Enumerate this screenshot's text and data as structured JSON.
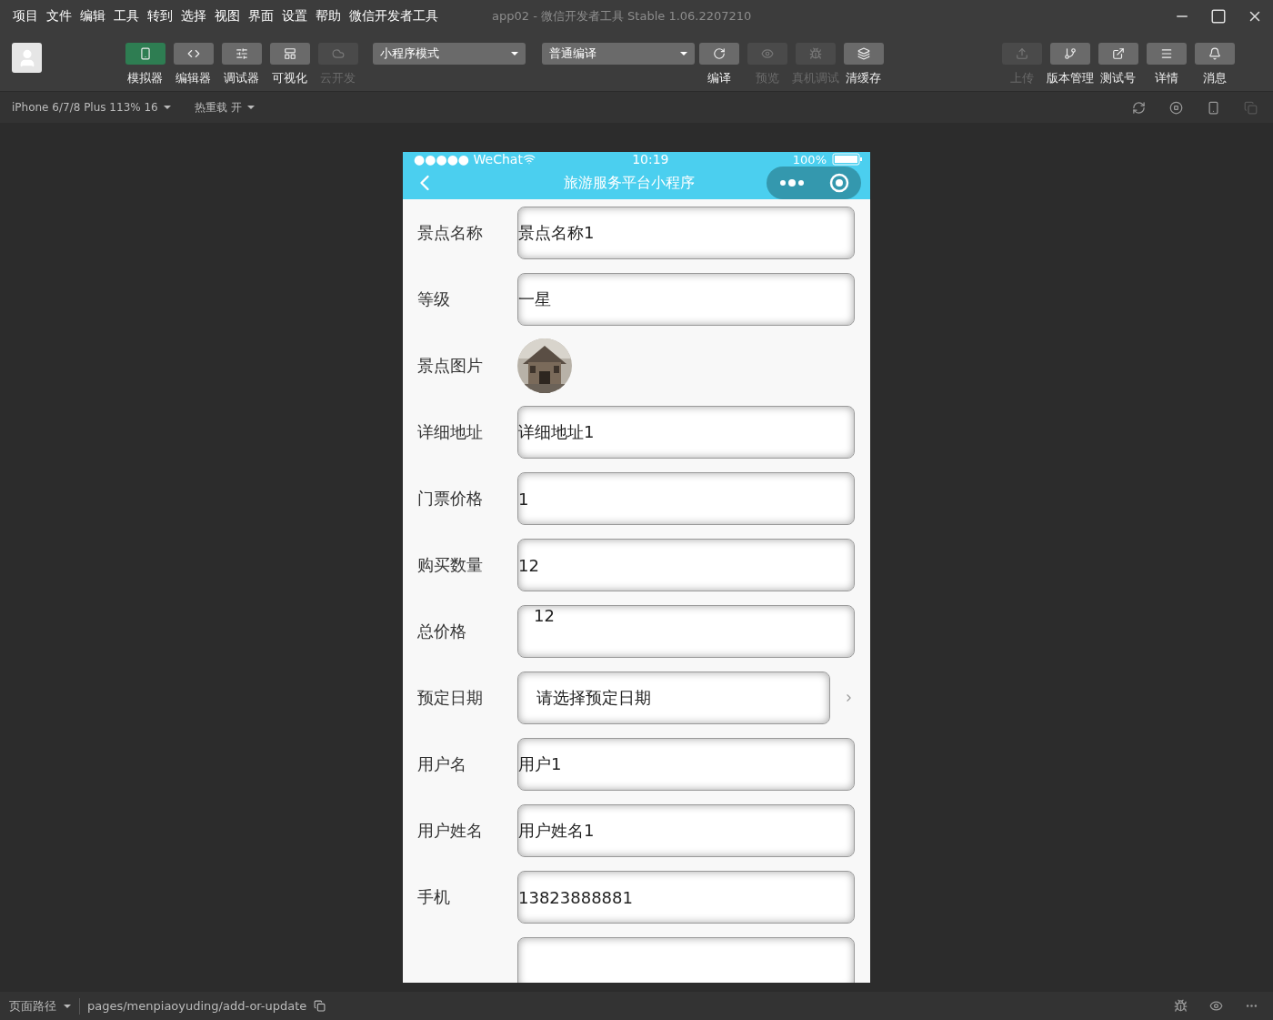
{
  "menu": [
    "项目",
    "文件",
    "编辑",
    "工具",
    "转到",
    "选择",
    "视图",
    "界面",
    "设置",
    "帮助",
    "微信开发者工具"
  ],
  "window": {
    "title": "app02 - 微信开发者工具 Stable 1.06.2207210"
  },
  "left_tools": [
    {
      "label": "模拟器",
      "selected": true,
      "disabled": false
    },
    {
      "label": "编辑器",
      "selected": false,
      "disabled": false
    },
    {
      "label": "调试器",
      "selected": false,
      "disabled": false
    },
    {
      "label": "可视化",
      "selected": false,
      "disabled": false
    },
    {
      "label": "云开发",
      "selected": false,
      "disabled": true
    }
  ],
  "mode_select": {
    "value": "小程序模式"
  },
  "compile_select": {
    "value": "普通编译"
  },
  "mid_tools": [
    {
      "label": "编译",
      "disabled": false
    },
    {
      "label": "预览",
      "disabled": true
    },
    {
      "label": "真机调试",
      "disabled": true
    },
    {
      "label": "清缓存",
      "disabled": false
    }
  ],
  "right_tools": [
    {
      "label": "上传",
      "disabled": true
    },
    {
      "label": "版本管理",
      "disabled": false
    },
    {
      "label": "测试号",
      "disabled": false
    },
    {
      "label": "详情",
      "disabled": false
    },
    {
      "label": "消息",
      "disabled": false
    }
  ],
  "sub_bar": {
    "device": "iPhone 6/7/8 Plus 113% 16",
    "hot_reload": "热重载 开"
  },
  "phone": {
    "status": {
      "carrier": "●●●●● WeChat",
      "time": "10:19",
      "battery": "100%"
    },
    "nav_title": "旅游服务平台小程序",
    "rows": [
      {
        "kind": "field",
        "label": "景点名称",
        "value": "景点名称1"
      },
      {
        "kind": "field",
        "label": "等级",
        "value": "一星"
      },
      {
        "label": "景点图片"
      },
      {
        "kind": "field",
        "label": "详细地址",
        "value": "详细地址1"
      },
      {
        "kind": "field",
        "label": "门票价格",
        "value": "1"
      },
      {
        "kind": "field",
        "label": "购买数量",
        "value": "12"
      },
      {
        "kind": "area",
        "label": "总价格",
        "value": "12"
      },
      {
        "kind": "picker",
        "label": "预定日期",
        "placeholder": "请选择预定日期"
      },
      {
        "kind": "field",
        "label": "用户名",
        "value": "用户1"
      },
      {
        "kind": "field",
        "label": "用户姓名",
        "value": "用户姓名1"
      },
      {
        "kind": "field",
        "label": "手机",
        "value": "13823888881"
      },
      {
        "kind": "field"
      }
    ]
  },
  "status_bar": {
    "path_label": "页面路径",
    "path": "pages/menpiaoyuding/add-or-update"
  }
}
